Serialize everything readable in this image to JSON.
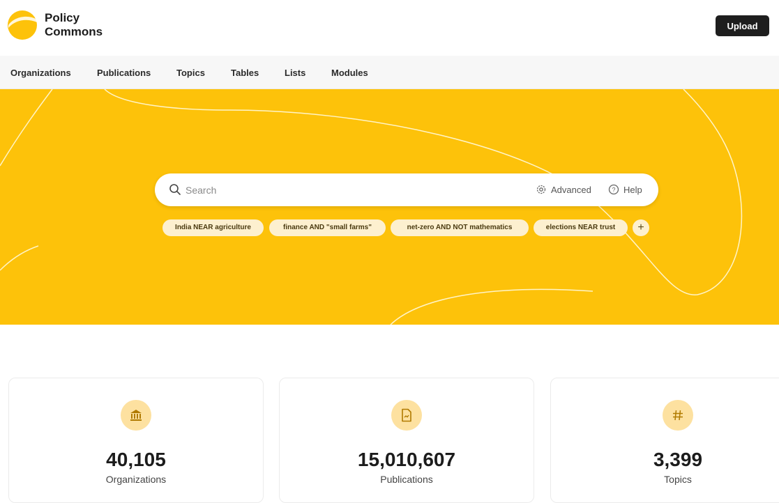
{
  "brand": {
    "name_line1": "Policy",
    "name_line2": "Commons",
    "accent": "#fdc20a"
  },
  "header": {
    "upload_label": "Upload"
  },
  "nav": {
    "items": [
      {
        "label": "Organizations"
      },
      {
        "label": "Publications"
      },
      {
        "label": "Topics"
      },
      {
        "label": "Tables"
      },
      {
        "label": "Lists"
      },
      {
        "label": "Modules"
      }
    ]
  },
  "search": {
    "placeholder": "Search",
    "advanced_label": "Advanced",
    "help_label": "Help",
    "chips": [
      {
        "label": "India NEAR agriculture"
      },
      {
        "label": "finance AND \"small farms\""
      },
      {
        "label": "net-zero AND NOT mathematics"
      },
      {
        "label": "elections NEAR trust"
      }
    ],
    "add_chip_label": "+"
  },
  "stats": [
    {
      "icon": "bank-icon",
      "value": "40,105",
      "label": "Organizations"
    },
    {
      "icon": "document-icon",
      "value": "15,010,607",
      "label": "Publications"
    },
    {
      "icon": "hash-icon",
      "value": "3,399",
      "label": "Topics"
    }
  ]
}
